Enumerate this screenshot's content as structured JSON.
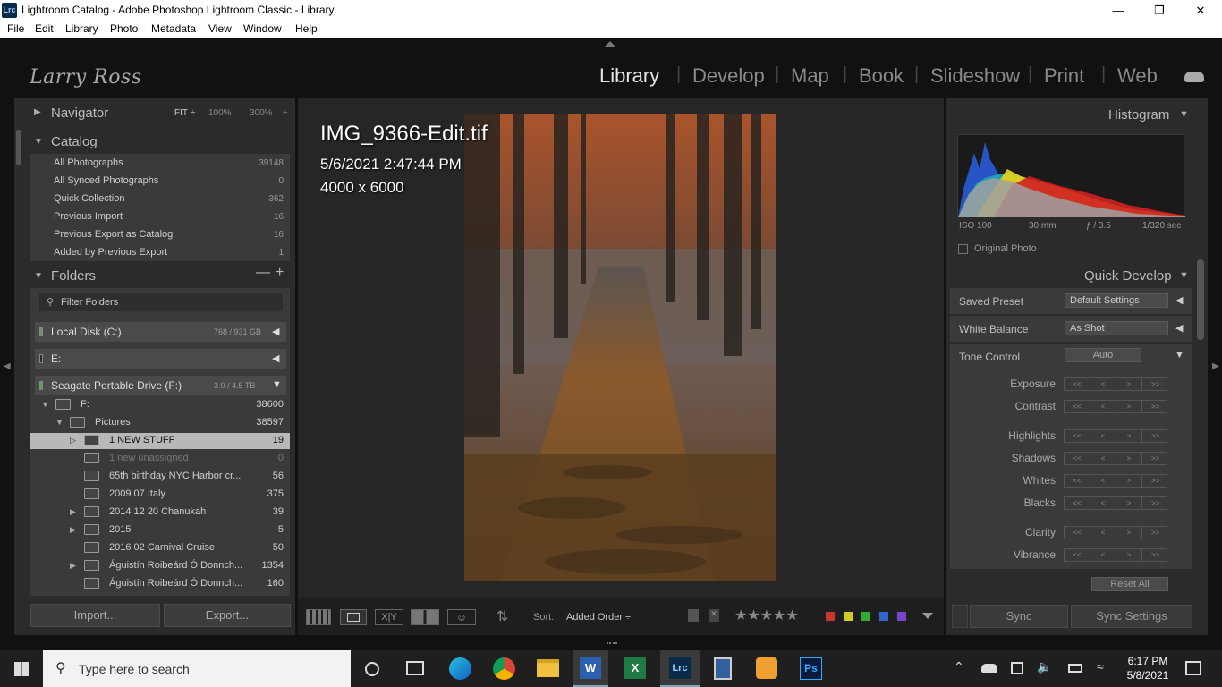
{
  "window": {
    "title": "Lightroom Catalog - Adobe Photoshop Lightroom Classic - Library",
    "app_badge": "Lrc"
  },
  "menu": [
    "File",
    "Edit",
    "Library",
    "Photo",
    "Metadata",
    "View",
    "Window",
    "Help"
  ],
  "identity_plate": "Larry Ross",
  "modules": [
    "Library",
    "Develop",
    "Map",
    "Book",
    "Slideshow",
    "Print",
    "Web"
  ],
  "navigator": {
    "title": "Navigator",
    "zoom": [
      "FIT ÷",
      "100%",
      "300%",
      "÷"
    ]
  },
  "catalog": {
    "title": "Catalog",
    "items": [
      {
        "label": "All Photographs",
        "count": "39148"
      },
      {
        "label": "All Synced Photographs",
        "count": "0"
      },
      {
        "label": "Quick Collection",
        "count": "362"
      },
      {
        "label": "Previous Import",
        "count": "16"
      },
      {
        "label": "Previous Export as Catalog",
        "count": "16"
      },
      {
        "label": "Added by Previous Export",
        "count": "1"
      }
    ]
  },
  "folders": {
    "title": "Folders",
    "filter_placeholder": "Filter Folders",
    "volumes": [
      {
        "label": "Local Disk (C:)",
        "size": "768 / 931 GB"
      },
      {
        "label": "E:",
        "size": ""
      },
      {
        "label": "Seagate Portable Drive (F:)",
        "size": "3.0 / 4.5 TB"
      }
    ],
    "tree": [
      {
        "label": "F:",
        "count": "38600"
      },
      {
        "label": "Pictures",
        "count": "38597"
      },
      {
        "label": "1 NEW STUFF",
        "count": "19"
      },
      {
        "label": "1 new unassigned",
        "count": "0"
      },
      {
        "label": "65th birthday NYC Harbor cr...",
        "count": "56"
      },
      {
        "label": "2009 07 Italy",
        "count": "375"
      },
      {
        "label": "2014 12 20 Chanukah",
        "count": "39"
      },
      {
        "label": "2015",
        "count": "5"
      },
      {
        "label": "2016 02 Carnival Cruise",
        "count": "50"
      },
      {
        "label": "Águistín Roibeárd Ó Donnch...",
        "count": "1354"
      },
      {
        "label": "Águistín Roibeárd Ó Donnch...",
        "count": "160"
      }
    ]
  },
  "buttons": {
    "import": "Import...",
    "export": "Export..."
  },
  "photo": {
    "filename": "IMG_9366-Edit.tif",
    "datetime": "5/6/2021 2:47:44 PM",
    "dimensions": "4000 x 6000"
  },
  "toolbar": {
    "sort_label": "Sort:",
    "sort_value": "Added Order ÷"
  },
  "color_labels": [
    "#cc3333",
    "#cccc22",
    "#33aa33",
    "#3366cc",
    "#7744cc"
  ],
  "histogram": {
    "title": "Histogram",
    "iso": "ISO 100",
    "focal": "30 mm",
    "aperture": "ƒ / 3.5",
    "shutter": "1/320 sec",
    "original_photo": "Original Photo"
  },
  "quick_develop": {
    "title": "Quick Develop",
    "saved_preset_label": "Saved Preset",
    "saved_preset_value": "Default Settings",
    "wb_label": "White Balance",
    "wb_value": "As Shot",
    "tone_label": "Tone Control",
    "auto": "Auto",
    "sliders": [
      "Exposure",
      "Contrast",
      "Highlights",
      "Shadows",
      "Whites",
      "Blacks",
      "Clarity",
      "Vibrance"
    ],
    "reset": "Reset All",
    "arrows": [
      "<<",
      "<",
      ">",
      ">>"
    ]
  },
  "sync": {
    "sync": "Sync",
    "sync_settings": "Sync Settings"
  },
  "taskbar": {
    "search_placeholder": "Type here to search",
    "time": "6:17 PM",
    "date": "5/8/2021"
  }
}
